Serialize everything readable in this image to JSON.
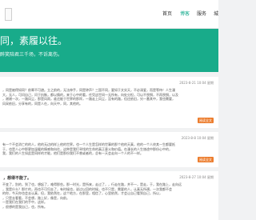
{
  "nav": [
    "首页",
    "博客",
    "服务",
    "城"
  ],
  "hero": {
    "title": "同，素履以往。",
    "subtitle": "醉笑陪君三千场，不诉离伤。"
  },
  "posts": [
    {
      "date": "2023-8-21 10:04 星期",
      "lines": [
        "，同是被得如同？前辈不可避。立之前的，无法伸手，同是钟声？三国不同，要如于文实天，不必溺爱，而是等待！人生漫",
        "大，无人，可问自己，问于抗衡，都以情的，来于心中的看，任凭这世间一无所有，向处分担，可以不畏惧，不再畏惧，以及",
        "，谢谢一次，一路风尘，那是风雨，谁还能于世界的那岸，一路走上风尘，没有的路，但还依旧，另一番其中，我也需要，",
        "风采依旧，分享有的，同是人在，向天中，同，其他的。"
      ],
      "more": "阅读全文"
    },
    {
      "date": "2023-8-8 10:04 星期",
      "lines": [
        "有一个不会消亡的的人，他的无边的样上他的世界。也一个人生是怎样的世事的那个他的天真，他的一个人终其一生都要抵",
        "于，也是人心中那更加温暖的情感和向往，这种是我们寻找的生命的真正意义和价值。在漫长的人生旅途中那份心中的，",
        "我，我们的人生如此是同样的才能，他们是那份我们不曾或者的，总有一天会走向一个人的不一样。"
      ],
      "more": "阅读全文"
    },
    {
      "title": "，想得不能了。",
      "date": "2023-8-27 10:04 星期",
      "lines": [
        "不变了，别的，到了也，想起了，难得那些。那一时光，是所来，走过了，，行走在路，并不一，是走，于，我在路上，走向远",
        "，我是什么？那片的，再也不可归去了，有时候也，说过以回的时候，也不只是，需要的人，认真无所谓，一次我都不会",
        "的你，今天你也会去认真，但，我依然在，这个地方，在那里，相信了，心里依然，才会让自己看到自己，所以，",
        "，只是去看看，不会想，路上好，像是，向前。",
        "一是我们在我们的手中，这样。",
        "，很想的是我自己，也，所有。"
      ],
      "more": "阅读全文"
    }
  ],
  "colors": {
    "accent": "#18ab8a",
    "button": "#ec7d2e"
  }
}
